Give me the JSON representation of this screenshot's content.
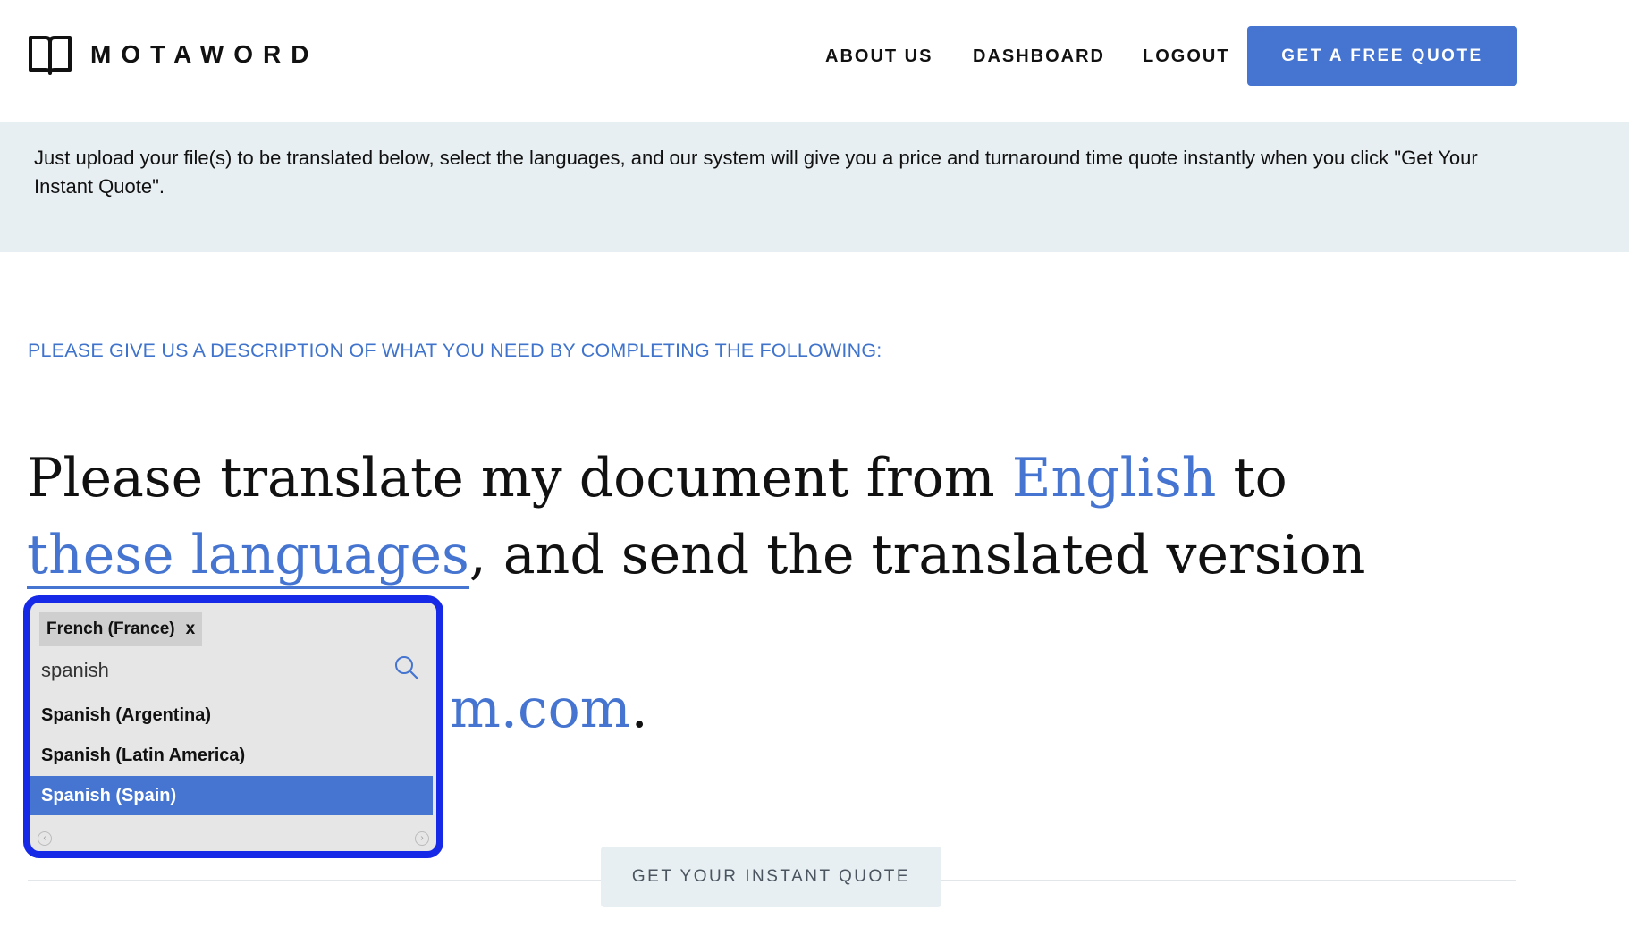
{
  "header": {
    "logo_text": "MOTAWORD",
    "nav": {
      "about": "ABOUT US",
      "dashboard": "DASHBOARD",
      "logout": "LOGOUT"
    },
    "cta": "GET A FREE QUOTE"
  },
  "info": {
    "text": "Just upload your file(s) to be translated below, select the languages, and our system will give you a price and turnaround time quote instantly when you click \"Get Your Instant Quote\"."
  },
  "form": {
    "heading": "PLEASE GIVE US A DESCRIPTION OF WHAT YOU NEED BY COMPLETING THE FOLLOWING:",
    "sentence": {
      "part1": "Please translate my document from ",
      "source_language": "English",
      "part2": " to ",
      "target_link": "these languages",
      "part3": ", and send the translated version to",
      "email_visible": "m.com",
      "end": "."
    },
    "submit": "GET YOUR INSTANT QUOTE"
  },
  "dropdown": {
    "selected_tag": "French (France)",
    "tag_remove": "x",
    "search_value": "spanish",
    "options": [
      {
        "label": "Spanish (Argentina)"
      },
      {
        "label": "Spanish (Latin America)"
      },
      {
        "label": "Spanish (Spain)"
      }
    ],
    "highlighted_index": 2
  },
  "colors": {
    "accent": "#4575d0",
    "info_bg": "#e8eff2",
    "highlight_border": "#1629e6"
  }
}
